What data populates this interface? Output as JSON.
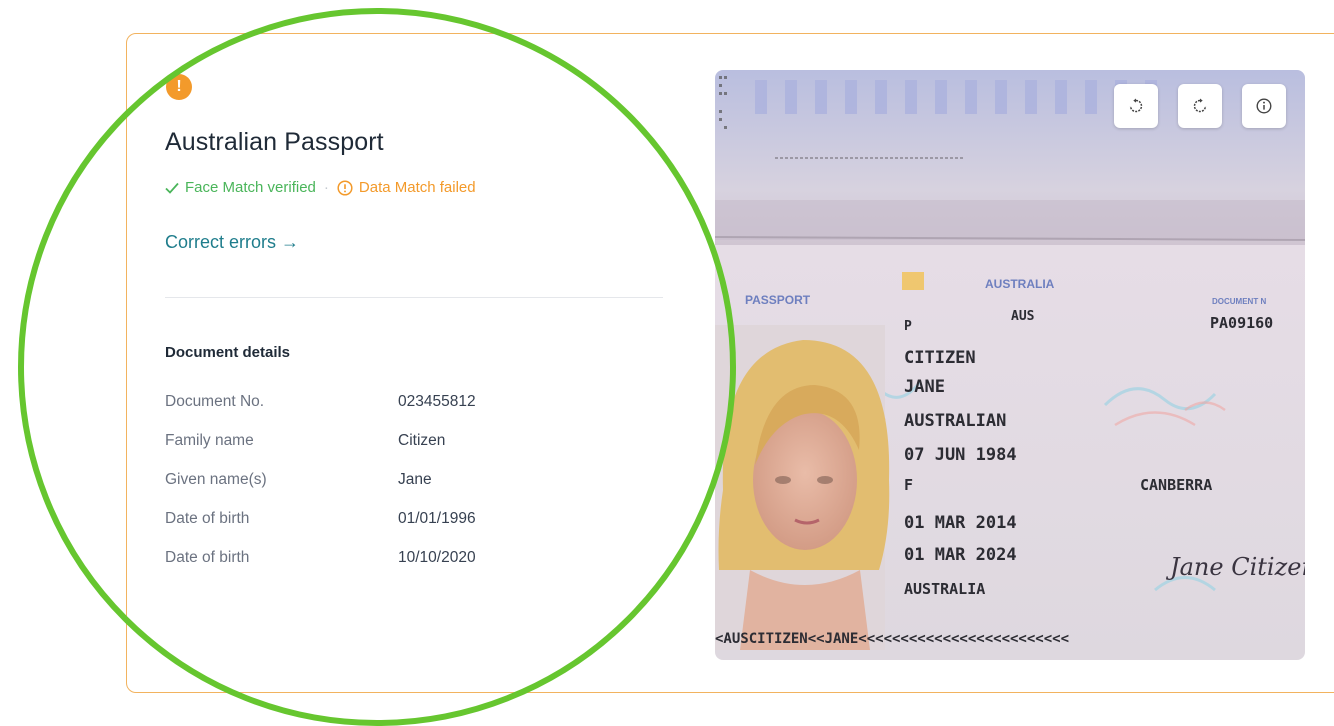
{
  "document": {
    "title": "Australian Passport",
    "face_match": "Face Match verified",
    "separator": "·",
    "data_match": "Data Match failed",
    "correct_link": "Correct errors →"
  },
  "details": {
    "heading": "Document details",
    "rows": [
      {
        "label": "Document No.",
        "value": "023455812"
      },
      {
        "label": "Family name",
        "value": "Citizen"
      },
      {
        "label": "Given name(s)",
        "value": "Jane"
      },
      {
        "label": "Date of birth",
        "value": "01/01/1996"
      },
      {
        "label": "Date of birth",
        "value": "10/10/2020"
      }
    ]
  },
  "passport_image": {
    "header_country": "AUSTRALIA",
    "passport_label": "PASSPORT",
    "document_label": "DOCUMENT N",
    "type": "P",
    "code": "AUS",
    "number": "PA09160",
    "surname": "CITIZEN",
    "given": "JANE",
    "nationality": "AUSTRALIAN",
    "dob": "07 JUN 1984",
    "sex": "F",
    "birthplace": "CANBERRA",
    "issue": "01 MAR 2014",
    "expiry": "01 MAR 2024",
    "authority": "AUSTRALIA",
    "mrz": "<AUSCITIZEN<<JANE<<<<<<<<<<<<<<<<<<<<<<<<<",
    "signature": "Jane Citizen"
  },
  "icons": {
    "warning": "warning-icon",
    "check": "check-icon",
    "alert": "alert-circle-icon",
    "rotate_left": "rotate-left-icon",
    "rotate_right": "rotate-right-icon",
    "info": "info-icon"
  },
  "colors": {
    "warning": "#f39a2b",
    "success": "#4ab55a",
    "link": "#1f7d8c",
    "card_border": "#f2b35f",
    "highlight_ring": "#66c62f"
  }
}
